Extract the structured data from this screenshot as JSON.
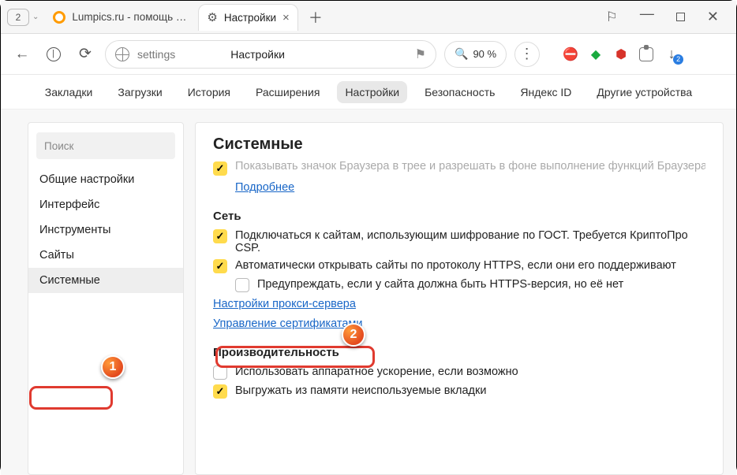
{
  "window": {
    "count": "2",
    "tabs": [
      {
        "title": "Lumpics.ru - помощь с ко"
      },
      {
        "title": "Настройки"
      }
    ]
  },
  "toolbar": {
    "address_keyword": "settings",
    "page_title": "Настройки",
    "zoom": "90 %",
    "download_badge": "2"
  },
  "reader_icon": "⚑",
  "navtabs": {
    "items": [
      "Закладки",
      "Загрузки",
      "История",
      "Расширения",
      "Настройки",
      "Безопасность",
      "Яндекс ID",
      "Другие устройства"
    ],
    "active_index": 4
  },
  "sidebar": {
    "search_placeholder": "Поиск",
    "items": [
      "Общие настройки",
      "Интерфейс",
      "Инструменты",
      "Сайты",
      "Системные"
    ],
    "active_index": 4
  },
  "content": {
    "heading": "Системные",
    "truncated_top": "Показывать значок Браузера в трее и разрешать в фоне выполнение функций Браузера",
    "more_link": "Подробнее",
    "section_network": "Сеть",
    "net_opt1": "Подключаться к сайтам, использующим шифрование по ГОСТ. Требуется КриптоПро CSP.",
    "net_opt2": "Автоматически открывать сайты по протоколу HTTPS, если они его поддерживают",
    "net_opt3": "Предупреждать, если у сайта должна быть HTTPS-версия, но её нет",
    "proxy_link": "Настройки прокси-сервера",
    "cert_link": "Управление сертификатами",
    "section_perf": "Производительность",
    "perf_opt1": "Использовать аппаратное ускорение, если возможно",
    "perf_opt2": "Выгружать из памяти неиспользуемые вкладки"
  },
  "callouts": {
    "one": "1",
    "two": "2"
  }
}
